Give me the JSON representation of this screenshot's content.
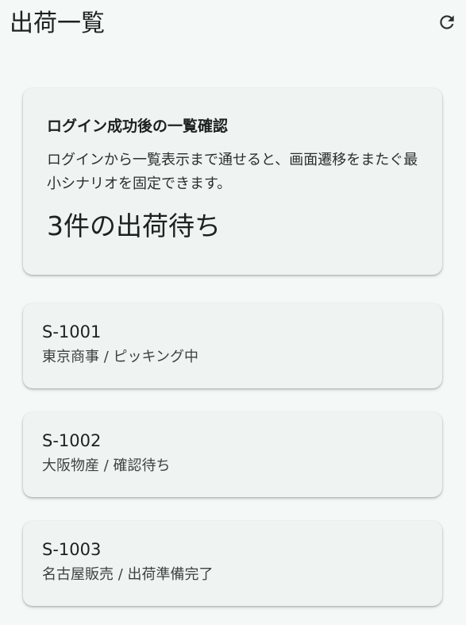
{
  "app_bar": {
    "title": "出荷一覧",
    "refresh_icon": "refresh-icon"
  },
  "summary": {
    "title": "ログイン成功後の一覧確認",
    "description": "ログインから一覧表示まで通せると、画面遷移をまたぐ最小シナリオを固定できます。",
    "count_text": "3件の出荷待ち"
  },
  "shipments": [
    {
      "id": "S-1001",
      "detail": "東京商事 / ピッキング中"
    },
    {
      "id": "S-1002",
      "detail": "大阪物産 / 確認待ち"
    },
    {
      "id": "S-1003",
      "detail": "名古屋販売 / 出荷準備完了"
    }
  ],
  "colors": {
    "background": "#f4f9f7",
    "card": "#eff3f1",
    "text": "#1d2120"
  }
}
